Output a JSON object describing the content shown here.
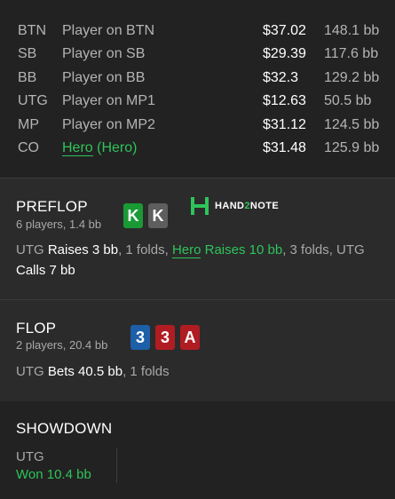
{
  "players": [
    {
      "pos": "BTN",
      "name": "Player on BTN",
      "stack": "$37.02",
      "bb": "148.1 bb"
    },
    {
      "pos": "SB",
      "name": "Player on SB",
      "stack": "$29.39",
      "bb": "117.6 bb"
    },
    {
      "pos": "BB",
      "name": "Player on BB",
      "stack": "$32.3",
      "bb": "129.2 bb"
    },
    {
      "pos": "UTG",
      "name": "Player on MP1",
      "stack": "$12.63",
      "bb": "50.5 bb"
    },
    {
      "pos": "MP",
      "name": "Player on MP2",
      "stack": "$31.12",
      "bb": "124.5 bb"
    },
    {
      "pos": "CO",
      "name": "Hero",
      "name_suffix": " (Hero)",
      "stack": "$31.48",
      "bb": "125.9 bb"
    }
  ],
  "preflop": {
    "title": "PREFLOP",
    "sub": "6 players, 1.4 bb",
    "cards": [
      "K",
      "K"
    ],
    "card_colors": [
      "#1a9a35",
      "#5e5e5e"
    ],
    "logo_a": "HAND",
    "logo_b": "2",
    "logo_c": "NOTE",
    "actions": {
      "a1": "UTG ",
      "a2": "Raises 3 bb",
      "a3": ", 1 folds, ",
      "a4": "Hero",
      "a5": " Raises 10 bb",
      "a6": ", 3 folds, UTG ",
      "a7": "Calls 7 bb"
    }
  },
  "flop": {
    "title": "FLOP",
    "sub": "2 players, 20.4 bb",
    "cards": [
      "3",
      "3",
      "A"
    ],
    "card_colors": [
      "#1d5fa8",
      "#b01c22",
      "#b01c22"
    ],
    "actions": {
      "a1": "UTG ",
      "a2": "Bets 40.5 bb",
      "a3": ", 1 folds"
    }
  },
  "showdown": {
    "title": "SHOWDOWN",
    "player": "UTG",
    "result": "Won 10.4 bb"
  },
  "colors": {
    "accent_green": "#2ec45a",
    "panel_dark": "#222222",
    "panel_mid": "#2b2b2b"
  }
}
